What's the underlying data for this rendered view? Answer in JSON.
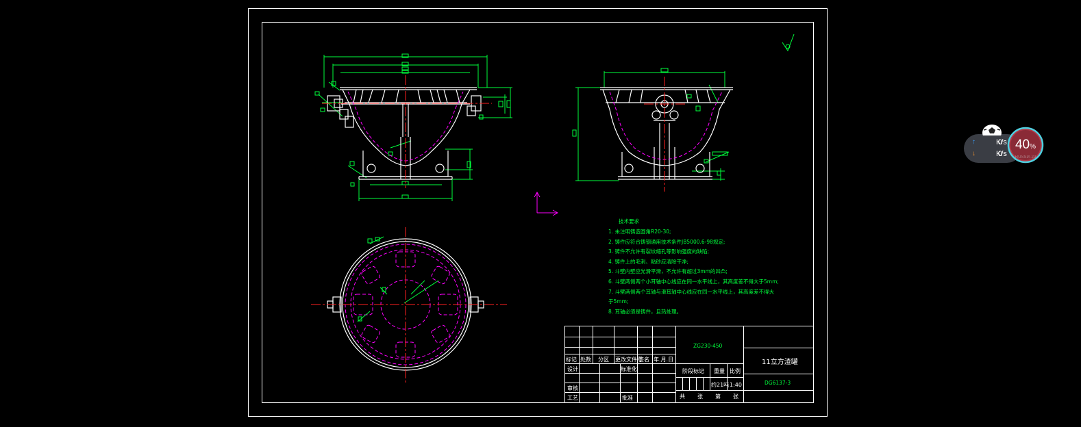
{
  "technical_requirements": {
    "title": "技术要求",
    "items": [
      "1. 未注明铸造圆角R20-30;",
      "2. 铸件应符合铸钢通用技术条件JB5000.6-98规定;",
      "3. 铸件不允许有裂纹缩孔等影响强度的缺陷;",
      "4. 铸件上的毛刺、粘砂应清除干净;",
      "5. 斗壁内壁应光滑平滑，不允许有超过3mm的凹凸;",
      "6. 斗壁两侧两个小耳轴中心线应在同一水平线上，其高度差不得大于5mm;",
      "7. 斗壁两侧两个耳轴与滑耳轴中心线应在同一水平线上，其高度差不得大",
      "于5mm;",
      "8. 耳轴必须是铸件，且热处理。"
    ]
  },
  "title_block": {
    "material": "ZG230-450",
    "part_name": "11立方渣罐",
    "drawing_number": "DG6137-3",
    "scale": "1:40",
    "header_labels": [
      "标记",
      "处数",
      "分区",
      "更改文件号",
      "签名",
      "年.月.日"
    ],
    "designer_label": "设计",
    "standardization_label": "标准化",
    "reviewer_label": "审核",
    "process_label": "工艺",
    "approval_label": "批准",
    "stage_label": "阶段标记",
    "weight_label": "重量",
    "scale_label": "比例",
    "weight_value": "约21吨",
    "sheet_labels": [
      "共",
      "张",
      "第",
      "张"
    ]
  },
  "network_widget": {
    "upload_value": "0",
    "download_value": "0",
    "unit": "K/s",
    "cpu_percent": "40",
    "percent_sign": "%",
    "upload_color": "#3aa0ff",
    "download_color": "#ff9a2e",
    "ring_color": "#4fd0e0"
  },
  "colors": {
    "background": "#000000",
    "outline": "#ffffff",
    "dimension": "#00ff3c",
    "hidden_line": "#ff00ff",
    "centerline": "#ff2020"
  }
}
